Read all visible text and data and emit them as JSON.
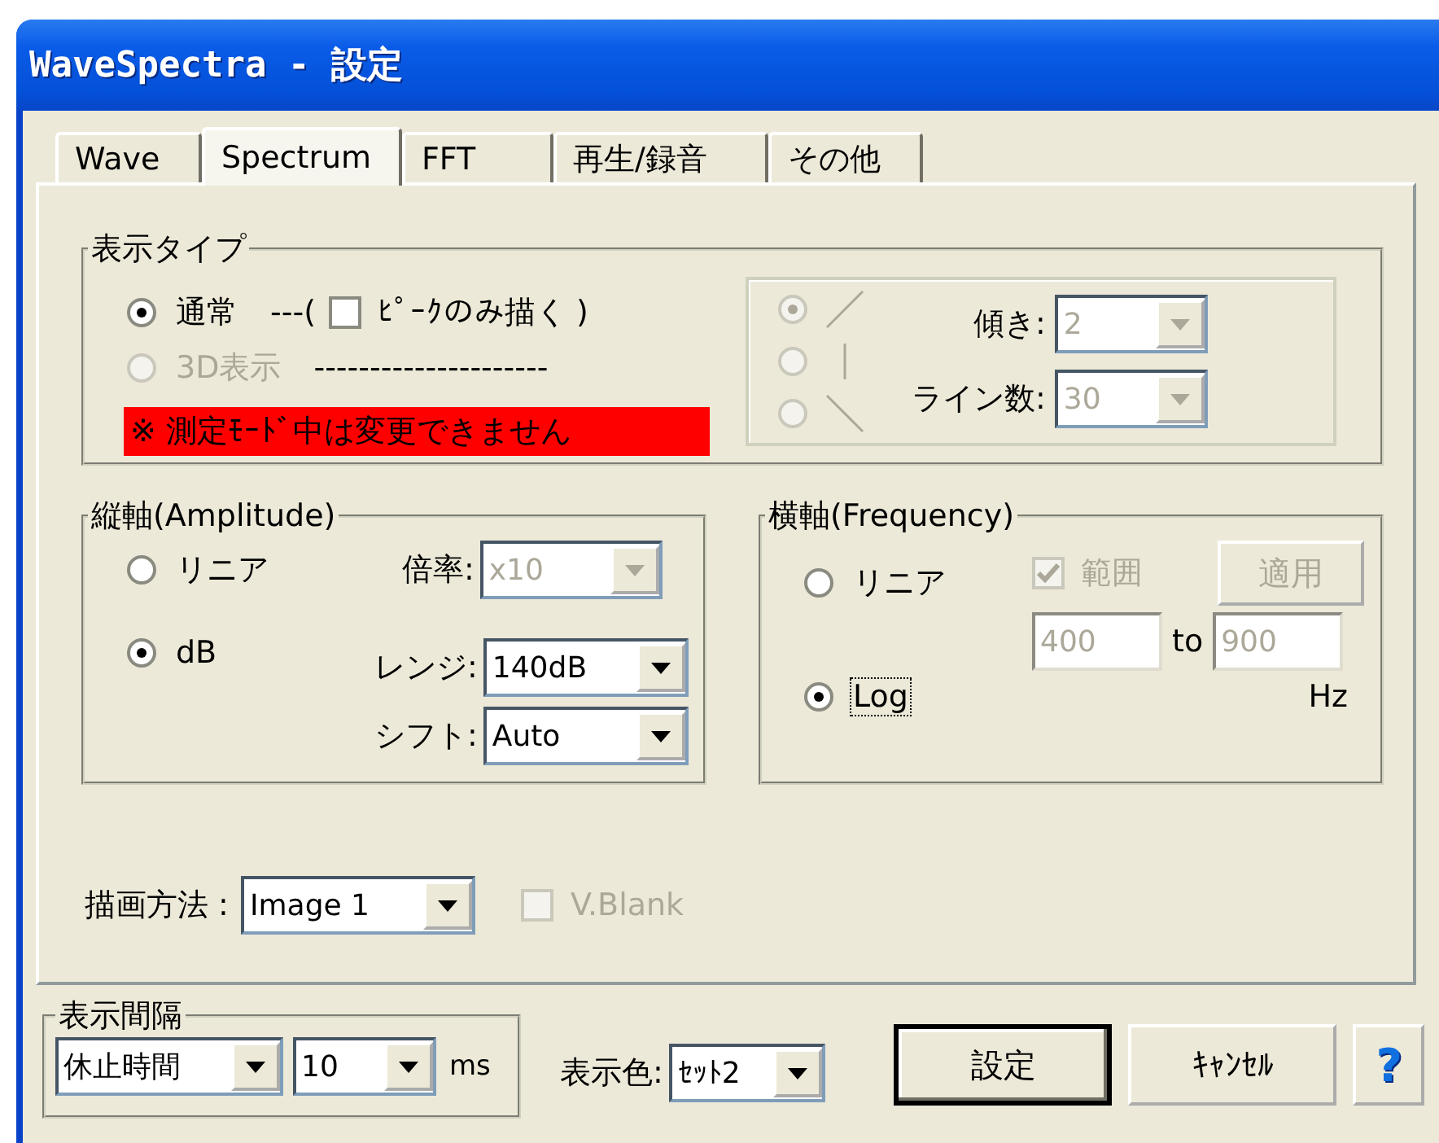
{
  "window": {
    "title": "WaveSpectra - 設定"
  },
  "tabs": [
    {
      "label": "Wave",
      "selected": false
    },
    {
      "label": "Spectrum",
      "selected": true
    },
    {
      "label": "FFT",
      "selected": false
    },
    {
      "label": "再生/録音",
      "selected": false
    },
    {
      "label": "その他",
      "selected": false
    }
  ],
  "display_type": {
    "title": "表示タイプ",
    "modes": [
      {
        "label": "通常",
        "selected": true,
        "disabled": false
      },
      {
        "label": "3D表示",
        "selected": false,
        "disabled": true
      }
    ],
    "peak_prefix": "---(",
    "peak_checkbox": {
      "label": "ﾋﾟｰｸのみ描く )",
      "checked": false
    },
    "mode_separator": "---------------------",
    "warning": "※ 測定ﾓｰﾄﾞ中は変更できません",
    "directions": [
      {
        "kind": "rising",
        "selected": true,
        "disabled": true
      },
      {
        "kind": "vertical",
        "selected": false,
        "disabled": true
      },
      {
        "kind": "falling",
        "selected": false,
        "disabled": true
      }
    ],
    "fields": [
      {
        "label": "傾き:",
        "value": "2",
        "disabled": true
      },
      {
        "label": "ライン数:",
        "value": "30",
        "disabled": true
      }
    ]
  },
  "amplitude": {
    "title": "縦軸(Amplitude)",
    "scales": [
      {
        "label": "リニア",
        "selected": false
      },
      {
        "label": "dB",
        "selected": true
      }
    ],
    "fields": [
      {
        "label": "倍率:",
        "value": "x10",
        "disabled": true
      },
      {
        "label": "レンジ:",
        "value": "140dB",
        "disabled": false
      },
      {
        "label": "シフト:",
        "value": "Auto",
        "disabled": false
      }
    ]
  },
  "frequency": {
    "title": "横軸(Frequency)",
    "scales": [
      {
        "label": "リニア",
        "selected": false,
        "focused": false
      },
      {
        "label": "Log",
        "selected": true,
        "focused": true
      }
    ],
    "range_checkbox": {
      "label": "範囲",
      "checked": true,
      "disabled": true
    },
    "apply_button": {
      "label": "適用",
      "disabled": true
    },
    "range_from": {
      "value": "400",
      "disabled": true
    },
    "range_separator": "to",
    "range_to": {
      "value": "900",
      "disabled": true
    },
    "unit": "Hz"
  },
  "draw_method": {
    "label": "描画方法 :",
    "value": "Image 1",
    "vblank": {
      "label": "V.Blank",
      "checked": false,
      "disabled": true
    }
  },
  "interval": {
    "title": "表示間隔",
    "mode": "休止時間",
    "value": "10",
    "unit": "ms"
  },
  "color": {
    "label": "表示色:",
    "value": "ｾｯﾄ2"
  },
  "buttons": [
    {
      "kind": "default",
      "label": "設定"
    },
    {
      "kind": "normal",
      "label": "ｷｬﾝｾﾙ"
    },
    {
      "kind": "help",
      "label": "?"
    }
  ]
}
